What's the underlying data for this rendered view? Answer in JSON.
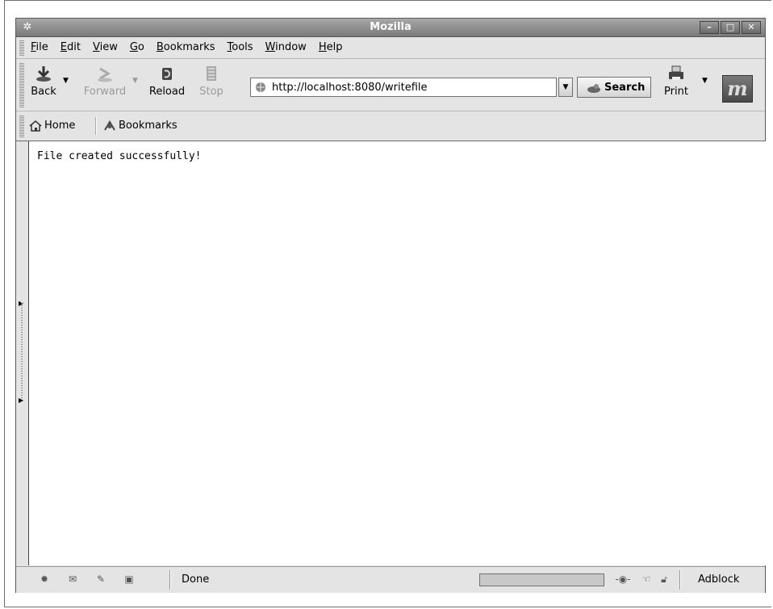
{
  "window": {
    "title": "Mozilla",
    "icon": "mozilla-app-icon"
  },
  "window_buttons": {
    "minimize": "–",
    "maximize": "□",
    "close": "✕"
  },
  "menu": {
    "items": [
      {
        "label": "File",
        "mnemonic": "F",
        "rest": "ile"
      },
      {
        "label": "Edit",
        "mnemonic": "E",
        "rest": "dit"
      },
      {
        "label": "View",
        "mnemonic": "V",
        "rest": "iew"
      },
      {
        "label": "Go",
        "mnemonic": "G",
        "rest": "o"
      },
      {
        "label": "Bookmarks",
        "mnemonic": "B",
        "rest": "ookmarks"
      },
      {
        "label": "Tools",
        "mnemonic": "T",
        "rest": "ools"
      },
      {
        "label": "Window",
        "mnemonic": "W",
        "rest": "indow"
      },
      {
        "label": "Help",
        "mnemonic": "H",
        "rest": "elp"
      }
    ]
  },
  "nav": {
    "back": "Back",
    "forward": "Forward",
    "reload": "Reload",
    "stop": "Stop",
    "url": "http://localhost:8080/writefile",
    "search": "Search",
    "print": "Print",
    "logo_letter": "m"
  },
  "personal_toolbar": {
    "home": "Home",
    "bookmarks": "Bookmarks"
  },
  "content": {
    "message": "File created successfully!"
  },
  "status": {
    "text": "Done",
    "adblock": "Adblock",
    "progress": 0
  }
}
